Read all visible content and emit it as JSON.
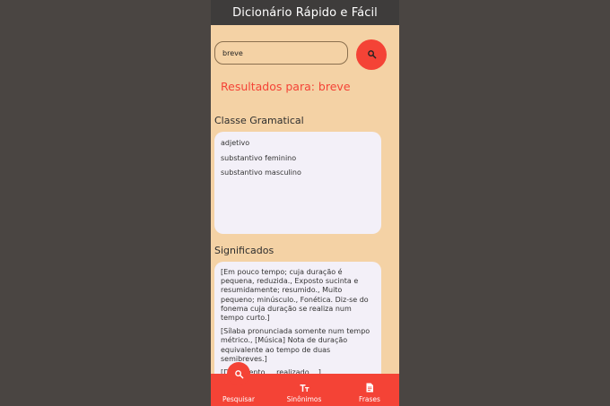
{
  "app": {
    "title": "Dicionário Rápido e Fácil"
  },
  "search": {
    "value": "breve",
    "button_icon": "search-icon"
  },
  "results": {
    "title": "Resultados para: breve"
  },
  "grammar": {
    "heading": "Classe Gramatical",
    "items": [
      "adjetivo",
      "substantivo feminino",
      "substantivo masculino"
    ]
  },
  "meanings": {
    "heading": "Significados",
    "items": [
      "[Em pouco tempo; cuja duração é pequena, reduzida., Exposto sucinta e resumidamente; resumido., Muito pequeno; minúsculo., Fonética. Diz-se do fonema cuja duração se realiza num tempo curto.]",
      "[Sílaba pronunciada somente num tempo métrico., [Música] Nota de duração equivalente ao tempo de duas semibreves.]",
      "[Documento ... realizado ...]"
    ]
  },
  "nav": {
    "items": [
      {
        "label": "Pesquisar",
        "icon": "search-icon"
      },
      {
        "label": "Sinônimos",
        "icon": "text-size-icon"
      },
      {
        "label": "Frases",
        "icon": "document-icon"
      }
    ]
  },
  "colors": {
    "accent": "#f44336",
    "background": "#f4d2a5",
    "appbar": "#3e3c3b",
    "card": "#f3f0f8"
  }
}
